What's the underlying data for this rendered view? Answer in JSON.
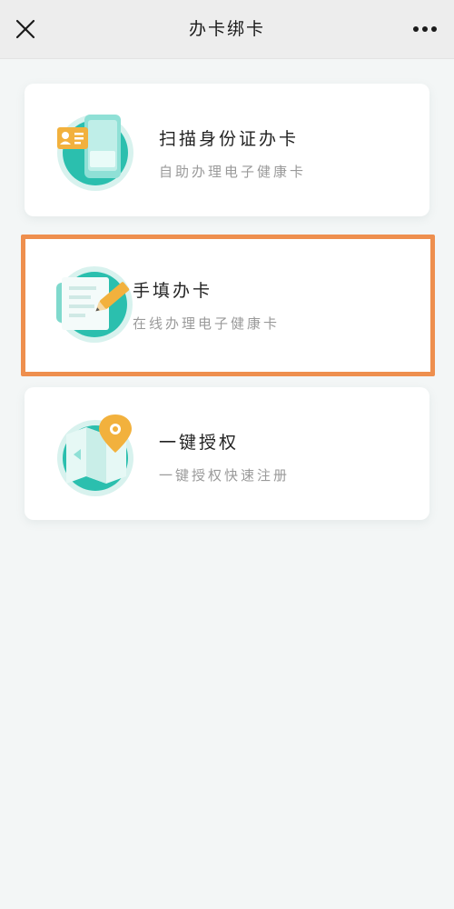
{
  "header": {
    "title": "办卡绑卡"
  },
  "options": [
    {
      "label": "扫描身份证办卡",
      "description": "自助办理电子健康卡",
      "icon": "id-card-scan-icon"
    },
    {
      "label": "手填办卡",
      "description": "在线办理电子健康卡",
      "icon": "manual-form-icon"
    },
    {
      "label": "一键授权",
      "description": "一键授权快速注册",
      "icon": "location-map-icon"
    }
  ],
  "colors": {
    "teal": "#2bbfae",
    "highlight_border": "#ee8f4e",
    "accent_orange": "#f2b13d"
  }
}
